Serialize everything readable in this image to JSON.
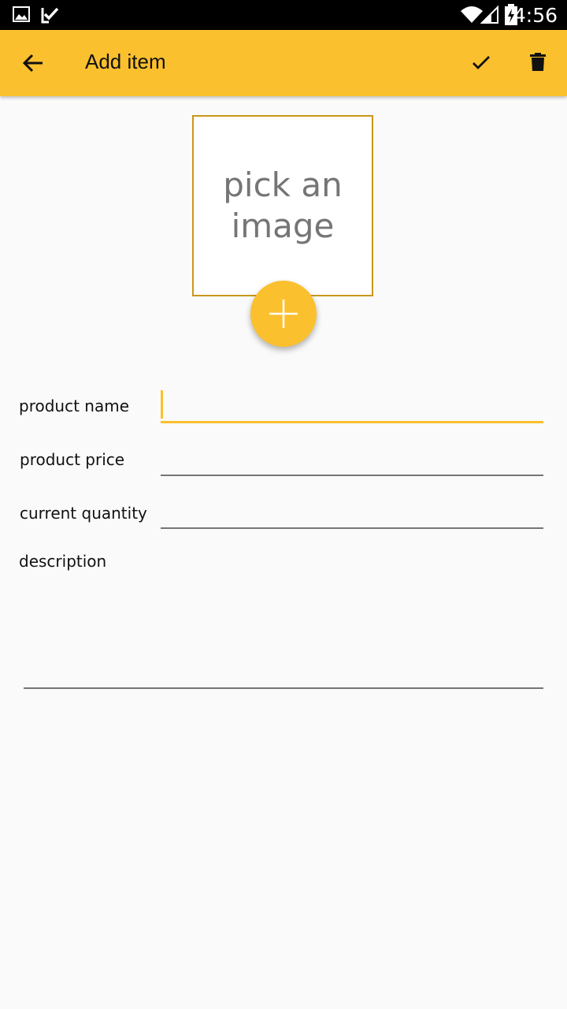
{
  "status_bar": {
    "time": "4:56",
    "icons": [
      "gallery-icon",
      "task-check-icon",
      "wifi-icon",
      "signal-icon",
      "battery-charging-icon"
    ]
  },
  "app_bar": {
    "title": "Add item",
    "back_icon": "arrow-back-icon",
    "save_icon": "check-icon",
    "delete_icon": "trash-icon"
  },
  "image_picker": {
    "placeholder": "pick an image",
    "add_icon": "plus-icon"
  },
  "form": {
    "product_name": {
      "label": "product name",
      "value": ""
    },
    "product_price": {
      "label": "product price",
      "value": ""
    },
    "current_quantity": {
      "label": "current quantity",
      "value": ""
    },
    "description": {
      "label": "description",
      "value": ""
    }
  },
  "colors": {
    "accent": "#fbc02d",
    "image_border": "#c9971a",
    "status_bar": "#000000"
  }
}
